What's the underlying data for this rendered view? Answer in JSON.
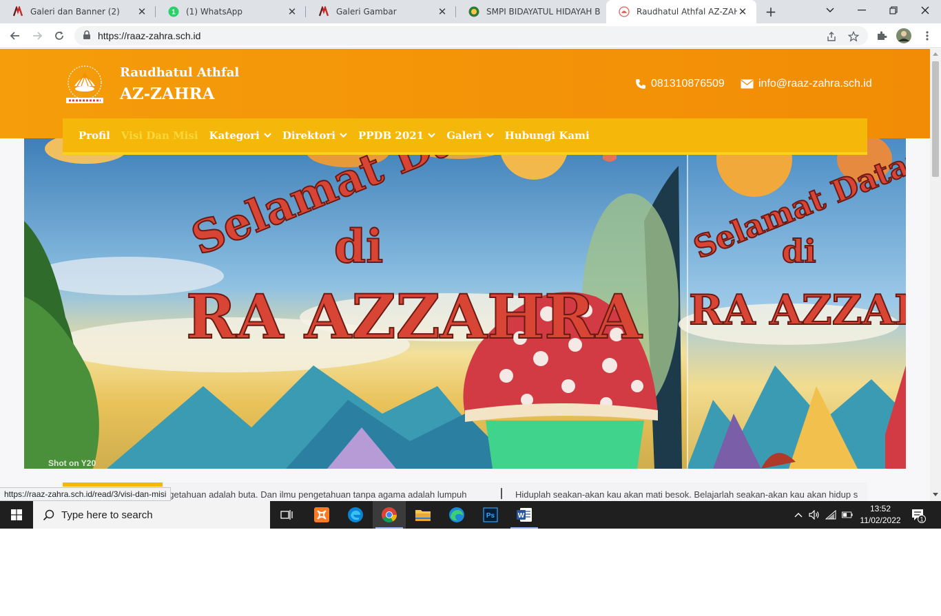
{
  "browser": {
    "tabs": [
      {
        "title": "Galeri dan Banner (2)",
        "icon": "site-logo-icon",
        "active": false
      },
      {
        "title": "(1) WhatsApp",
        "icon": "whatsapp-icon",
        "badge": "1",
        "active": false
      },
      {
        "title": "Galeri Gambar",
        "icon": "site-logo-icon",
        "active": false
      },
      {
        "title": "SMPI BIDAYATUL HIDAYAH B",
        "icon": "school-emblem-icon",
        "active": false
      },
      {
        "title": "Raudhatul Athfal AZ-ZAHRA",
        "icon": "raaz-logo-icon",
        "active": true
      }
    ],
    "close_glyph": "✕",
    "new_tab_glyph": "+",
    "url": "https://raaz-zahra.sch.id",
    "status_url": "https://raaz-zahra.sch.id/read/3/visi-dan-misi"
  },
  "site": {
    "brand_line1": "Raudhatul Athfal",
    "brand_line2": "AZ-ZAHRA",
    "phone": "081310876509",
    "email": "info@raaz-zahra.sch.id",
    "menu": [
      {
        "label": "Profil",
        "dropdown": false,
        "active": false
      },
      {
        "label": "Visi Dan Misi",
        "dropdown": false,
        "active": true
      },
      {
        "label": "Kategori",
        "dropdown": true,
        "active": false
      },
      {
        "label": "Direktori",
        "dropdown": true,
        "active": false
      },
      {
        "label": "PPDB 2021",
        "dropdown": true,
        "active": false
      },
      {
        "label": "Galeri",
        "dropdown": true,
        "active": false
      },
      {
        "label": "Hubungi Kami",
        "dropdown": false,
        "active": false
      }
    ],
    "hero": {
      "line1": "Selamat Datang",
      "line2": "di",
      "line3": "RA AZZAHRA",
      "watermark": "Shot on Y20"
    },
    "ticker": [
      "ngetahuan adalah buta. Dan ilmu pengetahuan tanpa agama adalah lumpuh",
      "Hiduplah seakan-akan kau akan mati besok. Belajarlah seakan-akan kau akan hidup s"
    ]
  },
  "taskbar": {
    "search_placeholder": "Type here to search",
    "time": "13:52",
    "date": "11/02/2022",
    "notification_count": "1"
  },
  "colors": {
    "header_orange": "#f59d0a",
    "menu_yellow": "#f5b80a",
    "menu_active": "#fbd83a",
    "hero_text_red": "#d84535"
  }
}
